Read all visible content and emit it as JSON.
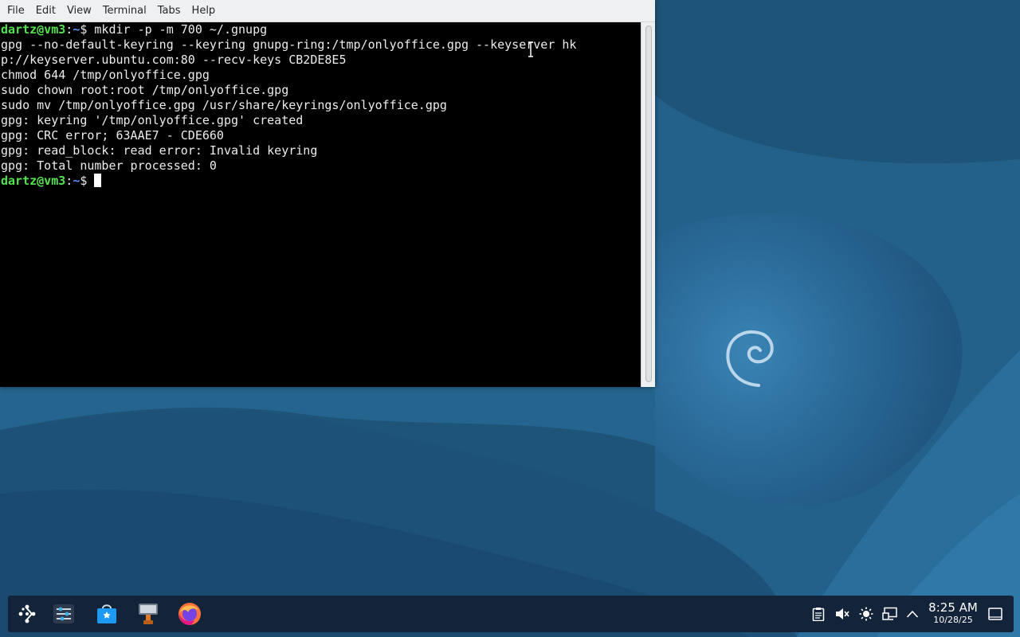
{
  "window": {
    "menus": [
      "File",
      "Edit",
      "View",
      "Terminal",
      "Tabs",
      "Help"
    ]
  },
  "terminal": {
    "prompt_user": "dartz@vm3",
    "prompt_path": "~",
    "lines": [
      {
        "type": "prompt",
        "text": "$ mkdir -p -m 700 ~/.gnupg"
      },
      {
        "type": "output",
        "text": "gpg --no-default-keyring --keyring gnupg-ring:/tmp/onlyoffice.gpg --keyserver hk"
      },
      {
        "type": "output",
        "text": "p://keyserver.ubuntu.com:80 --recv-keys CB2DE8E5"
      },
      {
        "type": "output",
        "text": "chmod 644 /tmp/onlyoffice.gpg"
      },
      {
        "type": "output",
        "text": "sudo chown root:root /tmp/onlyoffice.gpg"
      },
      {
        "type": "output",
        "text": "sudo mv /tmp/onlyoffice.gpg /usr/share/keyrings/onlyoffice.gpg"
      },
      {
        "type": "output",
        "text": "gpg: keyring '/tmp/onlyoffice.gpg' created"
      },
      {
        "type": "output",
        "text": "gpg: CRC error; 63AAE7 - CDE660"
      },
      {
        "type": "output",
        "text": "gpg: read_block: read error: Invalid keyring"
      },
      {
        "type": "output",
        "text": "gpg: Total number processed: 0"
      },
      {
        "type": "prompt",
        "text": "$ ",
        "cursor": true
      }
    ]
  },
  "taskbar": {
    "apps": [
      {
        "name": "application-launcher-icon"
      },
      {
        "name": "system-settings-icon"
      },
      {
        "name": "discover-store-icon"
      },
      {
        "name": "konsole-terminal-icon"
      },
      {
        "name": "firefox-icon"
      }
    ],
    "tray": [
      {
        "name": "clipboard-icon"
      },
      {
        "name": "volume-muted-icon"
      },
      {
        "name": "brightness-icon"
      },
      {
        "name": "network-icon"
      },
      {
        "name": "tray-expand-arrow-icon"
      }
    ],
    "clock_time": "8:25 AM",
    "clock_date": "10/28/25"
  },
  "colors": {
    "prompt_user": "#54e34f",
    "prompt_path": "#5c8ff7",
    "terminal_bg": "#000000",
    "taskbar_bg": "#13233a",
    "wallpaper_base": "#1c4a6b"
  }
}
